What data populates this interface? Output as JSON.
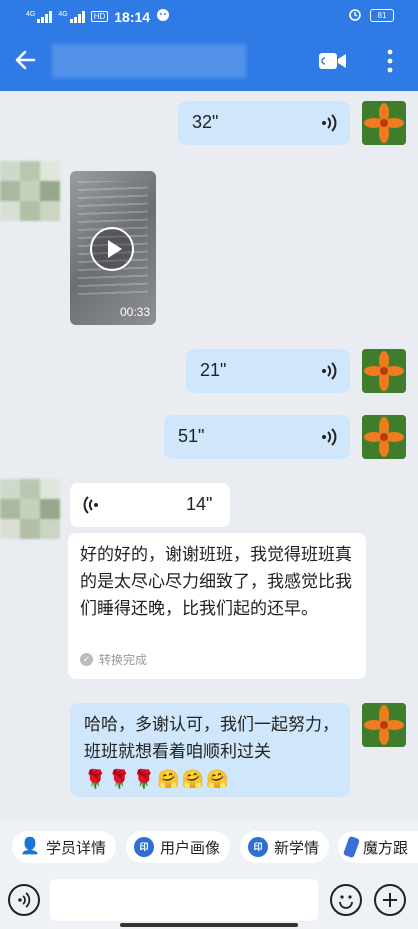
{
  "status_bar": {
    "network_1": "4G",
    "network_2": "4G",
    "hd_label": "HD",
    "time": "18:14",
    "battery": "81"
  },
  "header": {
    "back_icon": "arrow-left-icon",
    "video_call_icon": "video-camera-icon",
    "more_icon": "more-vertical-icon"
  },
  "messages": {
    "voice_1": {
      "duration": "32\""
    },
    "video_msg": {
      "length": "00:33"
    },
    "voice_2": {
      "duration": "21\""
    },
    "voice_3": {
      "duration": "51\""
    },
    "voice_4": {
      "duration": "14\""
    },
    "transcript": {
      "text": "好的好的，谢谢班班，我觉得班班真的是太尽心尽力细致了，我感觉比我们睡得还晚，比我们起的还早。",
      "status": "转换完成"
    },
    "reply": {
      "text": "哈哈，多谢认可，我们一起努力，班班就想看着咱顺利过关",
      "emoji": "🌹🌹🌹🤗🤗🤗"
    }
  },
  "toolbar_chips": [
    {
      "label": "学员详情",
      "icon": "person-icon"
    },
    {
      "label": "用户画像",
      "icon": "portrait-icon",
      "glyph": "印"
    },
    {
      "label": "新学情",
      "icon": "learning-icon",
      "glyph": "印"
    },
    {
      "label": "魔方跟",
      "icon": "cube-icon"
    }
  ],
  "input_bar": {
    "voice_icon": "voice-toggle-icon",
    "placeholder": "",
    "emoji_icon": "smiley-icon",
    "add_icon": "plus-circle-icon"
  },
  "colors": {
    "header_bg": "#2f7be6",
    "bubble_self": "#cfe6fb",
    "bubble_other": "#ffffff",
    "chat_bg": "#e9ecf1"
  }
}
